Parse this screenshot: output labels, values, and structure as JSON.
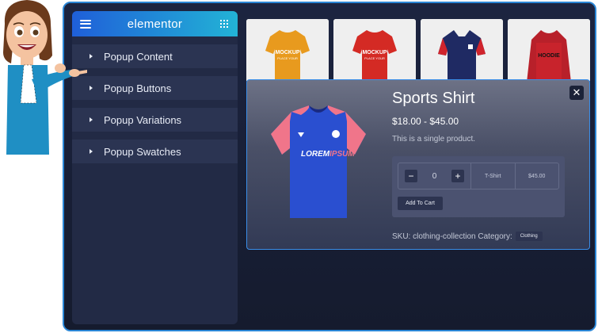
{
  "sidebar": {
    "title": "elementor",
    "items": [
      {
        "label": "Popup Content"
      },
      {
        "label": "Popup Buttons"
      },
      {
        "label": "Popup Variations"
      },
      {
        "label": "Popup Swatches"
      }
    ]
  },
  "thumbnails": [
    {
      "print": "MOCKUP",
      "subprint": "PLACE YOUR",
      "icon": "tshirt-orange-icon"
    },
    {
      "print": "MOCKUP",
      "subprint": "PLACE YOUR",
      "icon": "tshirt-red-icon"
    },
    {
      "print": "",
      "subprint": "",
      "icon": "polo-navy-icon"
    },
    {
      "print": "HOODIE",
      "subprint": "",
      "icon": "hoodie-red-icon"
    }
  ],
  "popup": {
    "close": "✕",
    "shirt_brand_a": "LOREM",
    "shirt_brand_b": "IPSUM",
    "title": "Sports Shirt",
    "price": "$18.00 - $45.00",
    "description": "This is a single product.",
    "qty_minus": "−",
    "qty_value": "0",
    "qty_plus": "+",
    "variant": "T-Shirt",
    "variant_price": "$45.00",
    "add_to_cart": "Add To Cart",
    "meta": "SKU: clothing-collection Category:",
    "category_tag": "Clothing"
  },
  "colors": {
    "accent_gradient_start": "#1f5fd8",
    "accent_gradient_end": "#22b3d6",
    "frame_border": "#2a86d6",
    "sidebar_bg": "#222a45",
    "shirt_blue": "#2a4fd0",
    "shirt_pink": "#f0758a"
  }
}
